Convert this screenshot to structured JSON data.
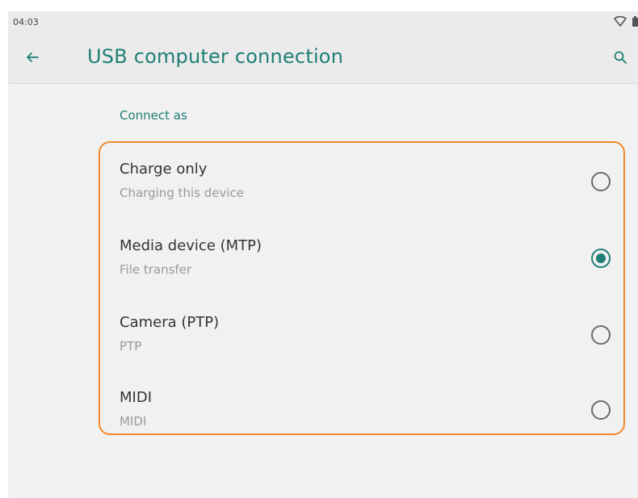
{
  "status_bar": {
    "time": "04:03",
    "icons": [
      "wifi-icon",
      "battery-icon"
    ]
  },
  "app_bar": {
    "title": "USB computer connection",
    "back_icon": "arrow-back-icon",
    "search_icon": "search-icon"
  },
  "section": {
    "header": "Connect as"
  },
  "options": [
    {
      "title": "Charge only",
      "subtitle": "Charging this device",
      "selected": false
    },
    {
      "title": "Media device (MTP)",
      "subtitle": "File transfer",
      "selected": true
    },
    {
      "title": "Camera (PTP)",
      "subtitle": "PTP",
      "selected": false
    },
    {
      "title": "MIDI",
      "subtitle": "MIDI",
      "selected": false
    }
  ],
  "colors": {
    "accent": "#1e7f76",
    "highlight_border": "#f08a2c",
    "background": "#f1f1f1"
  }
}
